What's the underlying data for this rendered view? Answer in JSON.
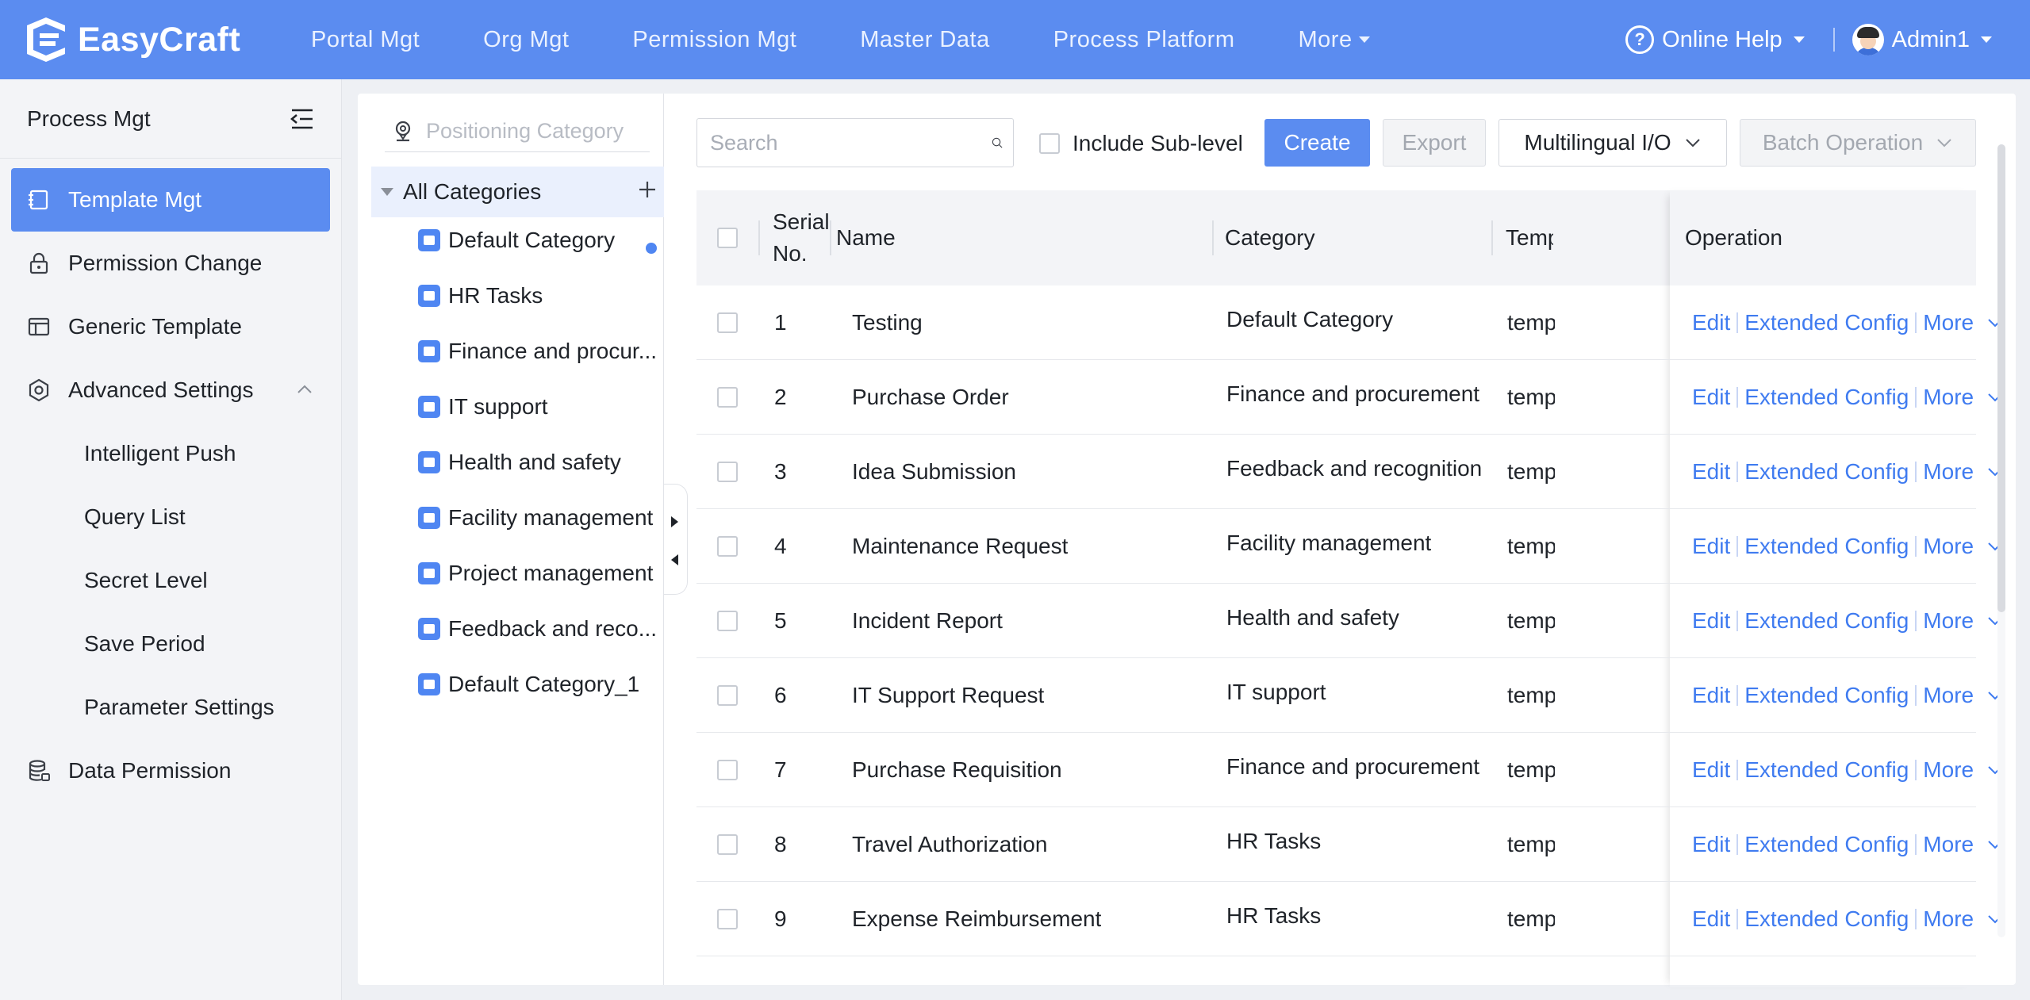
{
  "header": {
    "brand": "EasyCraft",
    "nav": [
      "Portal Mgt",
      "Org Mgt",
      "Permission Mgt",
      "Master Data",
      "Process Platform"
    ],
    "more_label": "More",
    "help_label": "Online Help",
    "user_name": "Admin1"
  },
  "sidebar": {
    "title": "Process Mgt",
    "items": [
      {
        "label": "Template Mgt",
        "icon": "template-icon",
        "active": true
      },
      {
        "label": "Permission Change",
        "icon": "lock-icon"
      },
      {
        "label": "Generic Template",
        "icon": "layout-icon"
      },
      {
        "label": "Advanced Settings",
        "icon": "gear-icon",
        "expanded": true
      }
    ],
    "sub_items": [
      "Intelligent Push",
      "Query List",
      "Secret Level",
      "Save Period",
      "Parameter Settings"
    ],
    "last_item": {
      "label": "Data Permission",
      "icon": "database-icon"
    }
  },
  "tree": {
    "search_placeholder": "Positioning Category",
    "root_label": "All Categories",
    "items": [
      "Default Category",
      "HR Tasks",
      "Finance and procur...",
      "IT support",
      "Health and safety",
      "Facility management",
      "Project management",
      "Feedback and reco...",
      "Default Category_1"
    ]
  },
  "toolbar": {
    "search_placeholder": "Search",
    "include_sublevel_label": "Include Sub-level",
    "create_label": "Create",
    "export_label": "Export",
    "multilingual_label": "Multilingual I/O",
    "batch_label": "Batch Operation"
  },
  "table": {
    "headers": {
      "serial_line1": "Serial",
      "serial_line2": "No.",
      "name": "Name",
      "category": "Category",
      "template": "Temp",
      "operation": "Operation"
    },
    "rows": [
      {
        "no": "1",
        "name": "Testing",
        "category": "Default Category",
        "template": "temp"
      },
      {
        "no": "2",
        "name": "Purchase Order",
        "category": "Finance and procurement",
        "template": "temp"
      },
      {
        "no": "3",
        "name": "Idea Submission",
        "category": "Feedback and recognition",
        "template": "temp"
      },
      {
        "no": "4",
        "name": "Maintenance Request",
        "category": "Facility management",
        "template": "temp"
      },
      {
        "no": "5",
        "name": "Incident Report",
        "category": "Health and safety",
        "template": "temp"
      },
      {
        "no": "6",
        "name": "IT Support Request",
        "category": "IT support",
        "template": "temp"
      },
      {
        "no": "7",
        "name": "Purchase Requisition",
        "category": "Finance and procurement",
        "template": "temp"
      },
      {
        "no": "8",
        "name": "Travel Authorization",
        "category": "HR Tasks",
        "template": "temp"
      },
      {
        "no": "9",
        "name": "Expense Reimbursement",
        "category": "HR Tasks",
        "template": "temp"
      }
    ],
    "operations": {
      "edit": "Edit",
      "extended": "Extended Config",
      "more": "More"
    }
  },
  "colors": {
    "primary": "#5b8cf0",
    "link": "#3f7bf0",
    "sidebar_bg": "#f3f4f7"
  }
}
